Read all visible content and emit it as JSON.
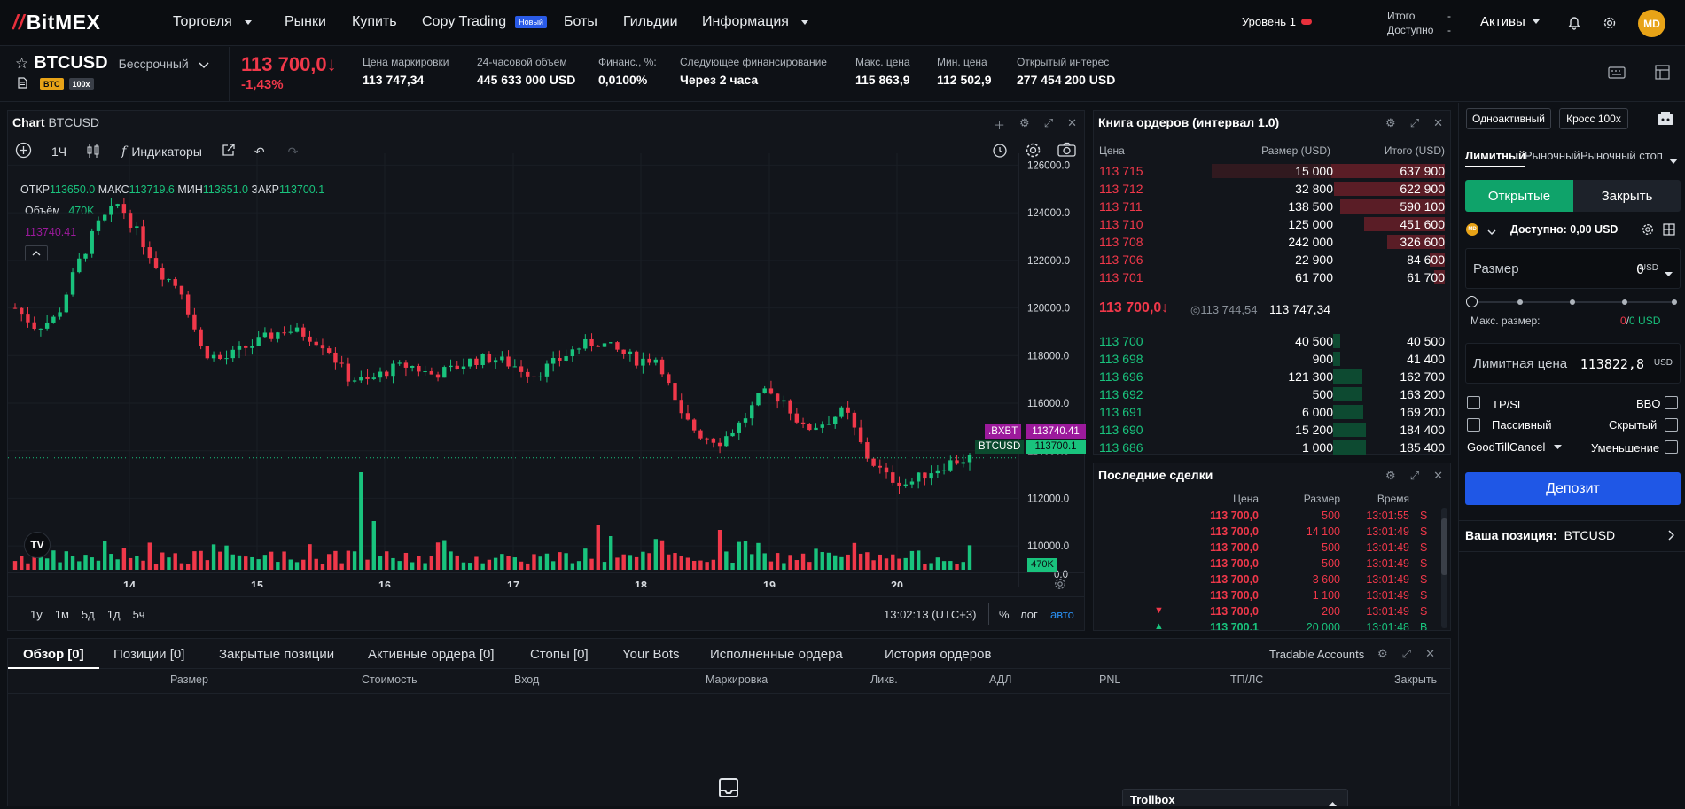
{
  "nav": {
    "logo": "BitMEX",
    "items": [
      {
        "label": "Торговля",
        "caret": true
      },
      {
        "label": "Рынки"
      },
      {
        "label": "Купить"
      },
      {
        "label": "Copy Trading",
        "badge": "Новый"
      },
      {
        "label": "Боты"
      },
      {
        "label": "Гильдии"
      },
      {
        "label": "Информация",
        "caret": true
      }
    ],
    "level": "Уровень 1",
    "totals": {
      "label1": "Итого",
      "label2": "Доступно",
      "dash1": "-",
      "dash2": "-"
    },
    "assets": "Активы",
    "avatar": "MD"
  },
  "ticker": {
    "symbol": "BTCUSD",
    "type": "Бессрочный",
    "tag_btc": "BTC",
    "tag_lev": "100x",
    "price": "113 700,0↓",
    "change": "-1,43%",
    "stats": [
      {
        "label": "Цена маркировки",
        "value": "113 747,34"
      },
      {
        "label": "24-часовой объем",
        "value": "445 633 000 USD"
      },
      {
        "label": "Финанс., %:",
        "value": "0,0100%"
      },
      {
        "label": "Следующее финансирование",
        "value": "Через 2 часа"
      },
      {
        "label": "Макс. цена",
        "value": "115 863,9"
      },
      {
        "label": "Мин. цена",
        "value": "112 502,9"
      },
      {
        "label": "Открытый интерес",
        "value": "277 454 200 USD"
      }
    ]
  },
  "chart": {
    "title": "Chart",
    "symbol": "BTCUSD",
    "interval": "1Ч",
    "indicators": "Индикаторы",
    "ohlc": {
      "o_label": "ОТКР",
      "o": "113650.0",
      "h_label": "МАКС",
      "h": "113719.6",
      "l_label": "МИН",
      "l": "113651.0",
      "c_label": "ЗАКР",
      "c": "113700.1"
    },
    "volume_label": "Объём",
    "volume_value": "470K",
    "index_value": "113740.41",
    "index_tag": ".BXBT",
    "index_price": "113740.41",
    "last_tag": "BTCUSD",
    "last_price": "113700.1",
    "vol_tag": "470K",
    "ranges": [
      "1у",
      "1м",
      "5д",
      "1д",
      "5ч"
    ],
    "time": "13:02:13 (UTC+3)",
    "pct": "%",
    "log": "лог",
    "auto": "авто",
    "colors": {
      "up": "#19c37d",
      "down": "#f0384a",
      "index": "#9c1a9c"
    }
  },
  "chart_data": {
    "type": "line",
    "title": "",
    "xlabel": "",
    "ylabel": "",
    "x_ticks": [
      "14",
      "15",
      "16",
      "17",
      "18",
      "19",
      "20"
    ],
    "y_ticks": [
      "126000.0",
      "124000.0",
      "122000.0",
      "120000.0",
      "118000.0",
      "116000.0",
      "114000.0",
      "112000.0",
      "110000.0",
      "0.0"
    ],
    "ylim": [
      109000,
      126500
    ],
    "series": [
      {
        "values": [
          120000,
          119200,
          119600,
          121800,
          123500,
          124400,
          123000,
          121500,
          120800,
          118200,
          117800,
          118300,
          118700,
          119100,
          118900,
          118400,
          117100,
          116900,
          117400,
          117600,
          117200,
          117400,
          117800,
          117900,
          117600,
          117200,
          117700,
          118300,
          118600,
          118200,
          117800,
          117900,
          115500,
          114700,
          114400,
          115200,
          116400,
          116200,
          114900,
          115200,
          115700,
          113800,
          112900,
          112600,
          113100,
          113500,
          113700
        ]
      }
    ]
  },
  "orderbook": {
    "title": "Книга ордеров (интервал 1.0)",
    "headers": {
      "price": "Цена",
      "size": "Размер (USD)",
      "total": "Итого (USD)"
    },
    "asks": [
      {
        "price": "113 715",
        "size": "15 000",
        "total": "637 900"
      },
      {
        "price": "113 712",
        "size": "32 800",
        "total": "622 900"
      },
      {
        "price": "113 711",
        "size": "138 500",
        "total": "590 100"
      },
      {
        "price": "113 710",
        "size": "125 000",
        "total": "451 600"
      },
      {
        "price": "113 708",
        "size": "242 000",
        "total": "326 600"
      },
      {
        "price": "113 706",
        "size": "22 900",
        "total": "84 600"
      },
      {
        "price": "113 701",
        "size": "61 700",
        "total": "61 700"
      }
    ],
    "mid": {
      "last": "113 700,0↓",
      "index": "113 744,54",
      "mark": "113 747,34"
    },
    "bids": [
      {
        "price": "113 700",
        "size": "40 500",
        "total": "40 500"
      },
      {
        "price": "113 698",
        "size": "900",
        "total": "41 400"
      },
      {
        "price": "113 696",
        "size": "121 300",
        "total": "162 700"
      },
      {
        "price": "113 692",
        "size": "500",
        "total": "163 200"
      },
      {
        "price": "113 691",
        "size": "6 000",
        "total": "169 200"
      },
      {
        "price": "113 690",
        "size": "15 200",
        "total": "184 400"
      },
      {
        "price": "113 686",
        "size": "1 000",
        "total": "185 400"
      }
    ]
  },
  "trades": {
    "title": "Последние сделки",
    "headers": {
      "price": "Цена",
      "size": "Размер",
      "time": "Время"
    },
    "rows": [
      {
        "price": "113 700,0",
        "size": "500",
        "time": "13:01:55",
        "side": "S"
      },
      {
        "price": "113 700,0",
        "size": "14 100",
        "time": "13:01:49",
        "side": "S"
      },
      {
        "price": "113 700,0",
        "size": "500",
        "time": "13:01:49",
        "side": "S"
      },
      {
        "price": "113 700,0",
        "size": "500",
        "time": "13:01:49",
        "side": "S"
      },
      {
        "price": "113 700,0",
        "size": "3 600",
        "time": "13:01:49",
        "side": "S"
      },
      {
        "price": "113 700,0",
        "size": "1 100",
        "time": "13:01:49",
        "side": "S"
      },
      {
        "price": "113 700,0",
        "size": "200",
        "time": "13:01:49",
        "side": "S"
      },
      {
        "price": "113 700,1",
        "size": "20 000",
        "time": "13:01:48",
        "side": "B"
      }
    ]
  },
  "order": {
    "mode1": "Одноактивный",
    "mode2": "Кросс 100x",
    "types": [
      "Лимитный",
      "Рыночный",
      "Рыночный стоп"
    ],
    "open": "Открытые",
    "close": "Закрыть",
    "account": "MD",
    "available": "Доступно: 0,00 USD",
    "size_label": "Размер",
    "size_value": "0",
    "size_unit": "USD",
    "max_label": "Макс. размер:",
    "max_value1": "0",
    "max_sep": "/",
    "max_value2": "0 USD",
    "limit_label": "Лимитная цена",
    "limit_value": "113822,8",
    "limit_unit": "USD",
    "tpsl": "TP/SL",
    "bbo": "BBO",
    "passive": "Пассивный",
    "hidden": "Скрытый",
    "tif": "GoodTillCancel",
    "reduce": "Уменьшение",
    "deposit": "Депозит",
    "position_label": "Ваша позиция:",
    "position_symbol": "BTCUSD"
  },
  "bottom": {
    "tabs": [
      "Обзор [0]",
      "Позиции [0]",
      "Закрытые позиции",
      "Активные ордера [0]",
      "Стопы [0]",
      "Your Bots",
      "Исполненные ордера",
      "История ордеров"
    ],
    "tradable": "Tradable Accounts",
    "columns": [
      "Размер",
      "Стоимость",
      "Вход",
      "Маркировка",
      "Ликв.",
      "АДЛ",
      "PNL",
      "ТП/ЛС",
      "Закрыть"
    ],
    "trollbox": "Trollbox"
  }
}
